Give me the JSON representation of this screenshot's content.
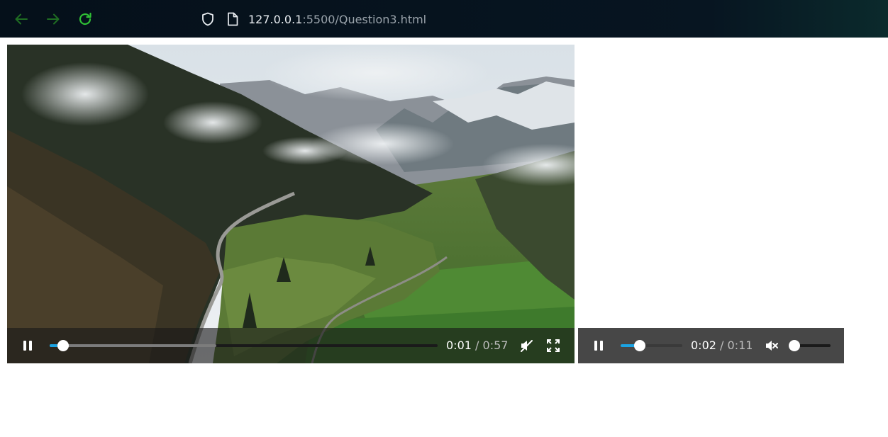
{
  "browser": {
    "url_host": "127.0.0.1",
    "url_rest": ":5500/Question3.html",
    "icons": [
      "back-arrow-icon",
      "forward-arrow-icon",
      "reload-icon",
      "shield-icon",
      "page-icon"
    ],
    "accent": "#2fbf35"
  },
  "video": {
    "current_time": "0:01",
    "separator": "/",
    "duration": "0:57",
    "progress_fraction": 0.02,
    "buffered_fraction": 0.43,
    "muted": true,
    "icons": [
      "pause-icon",
      "muted-icon",
      "fullscreen-icon"
    ]
  },
  "audio": {
    "current_time": "0:02",
    "separator": "/",
    "duration": "0:11",
    "progress_fraction": 0.26,
    "volume_fraction": 0.0,
    "muted": true,
    "icons": [
      "pause-icon",
      "muted-speaker-icon"
    ]
  },
  "colors": {
    "progress": "#1ba3e3",
    "controls_bg": "#474747"
  }
}
